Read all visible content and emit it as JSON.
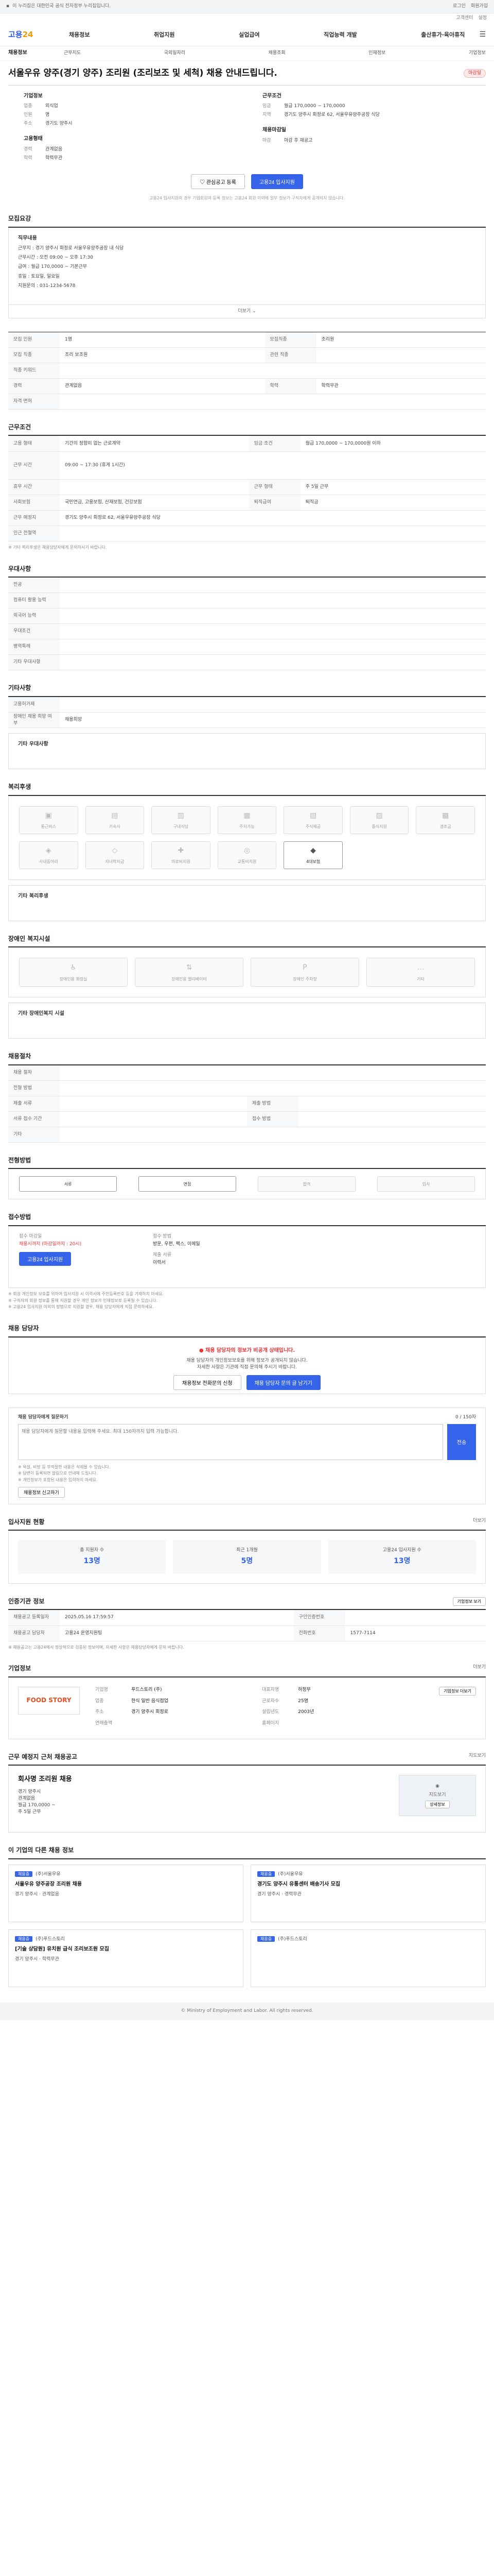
{
  "topbar": {
    "text": "이 누리집은 대한민국 공식 전자정부 누리집입니다.",
    "right": [
      "로그인",
      "회원가입"
    ]
  },
  "util": [
    "고객센터",
    "설정"
  ],
  "logo": {
    "main": "고용",
    "accent": "24"
  },
  "gnb": [
    "채용정보",
    "취업지원",
    "실업급여",
    "직업능력 개발",
    "출산휴가·육아휴직"
  ],
  "subnav": {
    "home": "채용정보",
    "items": [
      "근무지도",
      "국외일자리",
      "채용조회",
      "인재정보",
      "기업정보"
    ]
  },
  "job": {
    "title": "서울우유 양주(경기 양주) 조리원 (조리보조 및 세척) 채용 안내드립니다.",
    "badge": "마감일",
    "company_h": "기업정보",
    "company": [
      [
        "업종",
        "외식업"
      ],
      [
        "인원",
        "명"
      ],
      [
        "주소",
        "경기도 양주시"
      ]
    ],
    "cond_h": "근무조건",
    "cond": [
      [
        "임금",
        "월급 170,0000 ~ 170,0000"
      ],
      [
        "지역",
        "경기도 양주시 회정로 62, 서울우유양주공장 식당"
      ]
    ],
    "req_h": "고용형태",
    "req": [
      [
        "경력",
        "관계없음"
      ],
      [
        "학력",
        "학력무관"
      ]
    ],
    "apply_h": "채용마감일",
    "apply": [
      [
        "마감",
        "마감 후 재공고"
      ]
    ],
    "etc_h": "근무시간",
    "etc": [
      [
        "근무",
        "주 5일 근무"
      ]
    ],
    "btn_scrap": "관심공고 등록",
    "btn_apply": "고용24 입사지원",
    "notice": "고용24 입사지원의 경우 기업회원의 등록 정보는 고용24 회원 이외에 일부 정보가 구직자에게 공개되지 않습니다."
  },
  "duty": {
    "h": "모집요강",
    "sub": "직무내용",
    "lines": [
      "근무지 : 경기 양주시 회정로 서울우유양주공장 내 식당",
      "근무시간 : 오전 09:00 ~ 오후 17:30",
      "급여 : 월급 170,0000 ~ 기본근무",
      "휴일 : 토요일, 일요일",
      "지원문의 : 031-1234-5678"
    ],
    "toggle": "더보기"
  },
  "recruit": {
    "h": "",
    "rows": [
      [
        "모집 인원",
        "1명",
        "모집직종",
        "조리원"
      ],
      [
        "모집 직종",
        "조리 보조원",
        "관련 직종",
        ""
      ],
      [
        "직종 키워드",
        "",
        "",
        " "
      ],
      [
        "경력",
        "관계없음",
        "학력",
        "학력무관"
      ],
      [
        "자격 면허",
        "",
        "",
        ""
      ]
    ]
  },
  "work": {
    "h": "근무조건",
    "rows": [
      [
        "고용 형태",
        "기간의 정함이 없는 근로계약",
        "임금 조건",
        "월급 170,0000 ~ 170,0000원 이하"
      ],
      [
        "근무 시간",
        "09:00 ~ 17:30 (휴게 1시간)",
        "",
        ""
      ],
      [
        "휴무 시간",
        "",
        "근무 형태",
        "주 5일 근무"
      ],
      [
        "사회보험",
        "국민연금, 고용보험, 산재보험, 건강보험",
        "퇴직급여",
        "퇴직금"
      ],
      [
        "근무 예정지",
        "경기도 양주시 회정로 62, 서울우유양주공장 식당",
        "",
        ""
      ],
      [
        "인근 전철역",
        "",
        "",
        ""
      ]
    ],
    "note": "※ 기타 복리후생은 채용담당자에게 문의하시기 바랍니다."
  },
  "pref": {
    "h": "우대사항",
    "rows": [
      [
        "전공",
        ""
      ],
      [
        "컴퓨터 활용 능력",
        ""
      ],
      [
        "외국어 능력",
        ""
      ],
      [
        "우대조건",
        ""
      ],
      [
        "병역특례",
        ""
      ],
      [
        "기타 우대사항",
        ""
      ]
    ]
  },
  "other": {
    "h": "기타사항",
    "rows": [
      [
        "고용허가제",
        ""
      ],
      [
        "장애인 채용 희망 여부",
        "채용희망"
      ]
    ],
    "sub": "기타 우대사항"
  },
  "welfare": {
    "h": "복리후생",
    "items": [
      "통근버스",
      "기숙사",
      "구내식당",
      "주차가능",
      "주식제공",
      "중식지원",
      "경조금",
      "사내동아리",
      "자녀학자금",
      "의료비지원",
      "교통비지원",
      "4대보험"
    ],
    "on": [
      11
    ],
    "sub": "기타 복리후생"
  },
  "disab": {
    "h": "장애인 복지시설",
    "items": [
      "장애인용 화장실",
      "장애인용 엘리베이터",
      "장애인 주차장",
      "기타"
    ],
    "sub": "기타 장애인복지 시설"
  },
  "process": {
    "h": "채용절차",
    "rows": [
      [
        "채용 절차",
        "",
        "",
        ""
      ],
      [
        "전형 방법",
        "",
        "",
        ""
      ],
      [
        "제출 서류",
        "",
        "제출 방법",
        ""
      ],
      [
        "서류 접수 기간",
        "",
        "접수 방법",
        ""
      ],
      [
        "기타",
        "",
        "",
        ""
      ]
    ]
  },
  "steps": {
    "h": "전형방법",
    "items": [
      "서류",
      "면접",
      "합격",
      "입사"
    ]
  },
  "howto": {
    "h": "접수방법",
    "lbl1": "접수 마감일",
    "val1": "채용시까지 (마감일까지 : 20시)",
    "lbl2": "접수 방법",
    "val2": "방문, 우편, 팩스, 이메일",
    "lbl3": "제출 서류",
    "val3": "이력서",
    "btn": "고용24 입사지원",
    "notes": [
      "※ 회원 개인정보 보호를 위하여 입사지원 시 이력서에 주민등록번호 등을 기재하지 마세요.",
      "※ 구직자의 회원 정보를 통해 지원할 경우 개인 정보가 인재정보로 등록될 수 있습니다.",
      "※ 고용24 입사지원 이외의 방법으로 지원할 경우, 채용 담당자에게 직접 문의하세요."
    ]
  },
  "contact": {
    "h": "채용 담당자",
    "warn": "채용 담당자의 정보가 비공개 상태입니다.",
    "lines": [
      "채용 담당자의 개인정보보호를 위해 정보가 공개되지 않습니다.",
      "자세한 사항은 기관에 직접 문의해 주시기 바랍니다."
    ],
    "btn1": "채용정보 전화문의 신청",
    "btn2": "채용 담당자 문의 글 남기기"
  },
  "qa": {
    "h": "채용 담당자에게 질문하기",
    "count": "0 / 150자",
    "placeholder": "채용 담당자에게 질문할 내용을 입력해 주세요. 최대 150자까지 입력 가능합니다.",
    "send": "전송",
    "notes": [
      "※ 욕설, 비방 등 부적절한 내용은 삭제될 수 있습니다.",
      "※ 답변이 등록되면 알림으로 안내해 드립니다.",
      "※ 개인정보가 포함된 내용은 입력하지 마세요."
    ],
    "btn": "채용정보 신고하기"
  },
  "stats": {
    "h": "입사지원 현황",
    "more": "더보기",
    "items": [
      [
        "총 지원자 수",
        "13명"
      ],
      [
        "최근 1개월",
        "5명"
      ],
      [
        "고용24 입사지원 수",
        "13명"
      ]
    ]
  },
  "info": {
    "h": "인증기관 정보",
    "rows": [
      [
        "채용공고 등록일자",
        "2025.05.16 17:59:57",
        "구인인증번호",
        ""
      ],
      [
        "채용공고 담당자",
        "고용24 운영지원팀",
        "전화번호",
        "1577-7114"
      ]
    ],
    "note": "※ 채용공고는 고용24에서 정상적으로 검증된 정보이며, 자세한 사항은 채용담당자에게 문의 바랍니다.",
    "btn": "기업정보 보기"
  },
  "company": {
    "h": "기업정보",
    "more": "더보기",
    "logo": "FOOD STORY",
    "rows": [
      [
        "기업명",
        "푸드스토리 (주)"
      ],
      [
        "대표자명",
        "허정무"
      ],
      [
        "업종",
        "한식 일반 음식점업"
      ],
      [
        "근로자수",
        "25명"
      ],
      [
        "주소",
        "경기 양주시 회정로"
      ],
      [
        "설립년도",
        "2003년"
      ],
      [
        "연매출액",
        ""
      ],
      [
        "홈페이지",
        ""
      ]
    ],
    "btn": "기업정보 더보기"
  },
  "near": {
    "h": "근무 예정지 근처 채용공고",
    "more": "지도보기",
    "title": "회사명 조리원 채용",
    "lines": [
      "경기 양주시",
      "관계없음",
      "월급 170,0000 ~",
      "주 5일 근무"
    ],
    "map_label": "지도보기",
    "map_btn": "상세정보"
  },
  "rec": {
    "h": "이 기업의 다른 채용 정보",
    "cards": [
      {
        "tag": "채용중",
        "co": "(주)서울우유",
        "t": "서울우유 양주공장 조리원 채용",
        "m": "경기 양주시 · 관계없음"
      },
      {
        "tag": "채용중",
        "co": "(주)서울우유",
        "t": "경기도 양주시 유통센터 배송기사 모집",
        "m": "경기 양주시 · 경력무관"
      },
      {
        "tag": "채용중",
        "co": "(주)푸드스토리",
        "t": "[기술 상담원] 유치원 급식 조리보조원 모집",
        "m": "경기 양주시 · 학력무관"
      },
      {
        "tag": "채용중",
        "co": "(주)푸드스토리",
        "t": "",
        "m": ""
      }
    ]
  },
  "footer": "© Ministry of Employment and Labor. All rights reserved."
}
